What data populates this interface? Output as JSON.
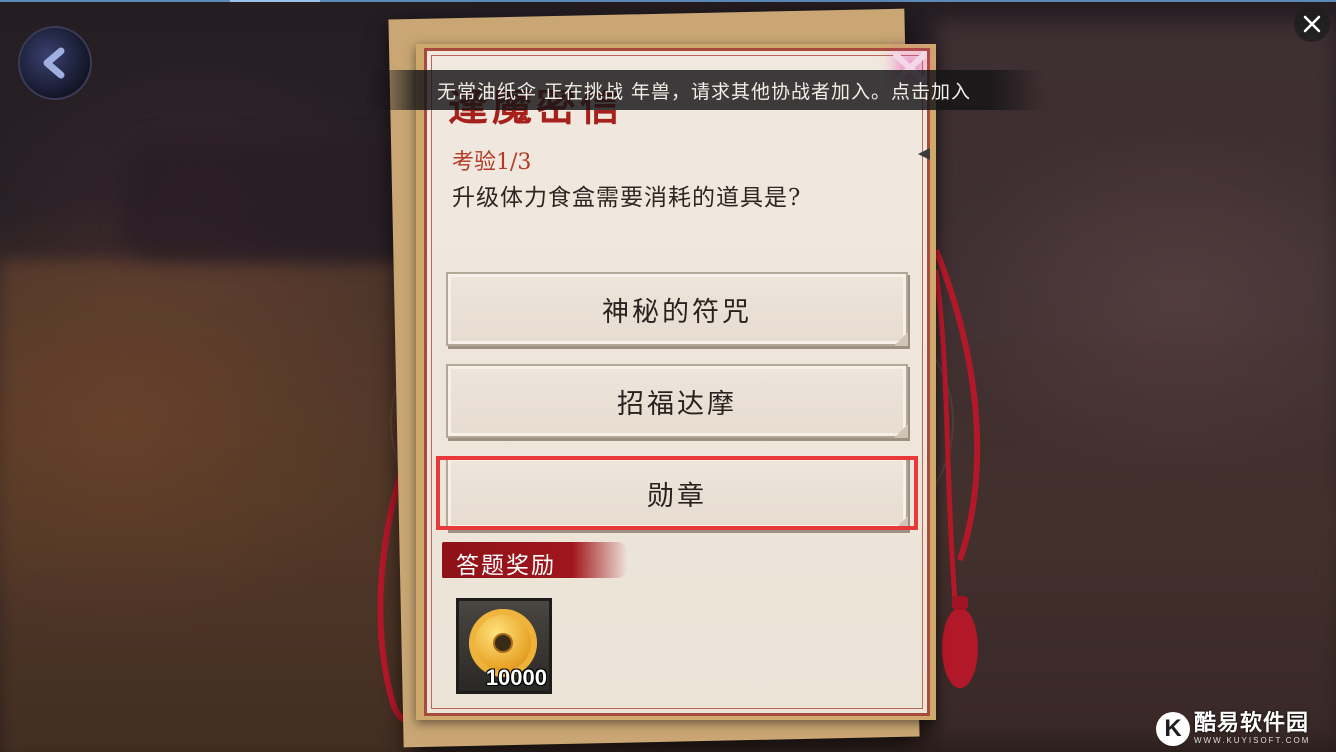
{
  "notice": {
    "text": "无常油纸伞 正在挑战 年兽，请求其他协战者加入。点击加入"
  },
  "card": {
    "title": "逢魔密信",
    "question_number": "考验1/3",
    "question_text": "升级体力食盒需要消耗的道具是?"
  },
  "options": [
    {
      "label": "神秘的符咒"
    },
    {
      "label": "招福达摩"
    },
    {
      "label": "勋章",
      "highlighted": true
    }
  ],
  "reward": {
    "label": "答题奖励",
    "item_icon": "coin-icon",
    "count": "10000"
  },
  "watermark": {
    "logo_letter": "K",
    "text": "酷易软件园",
    "url": "WWW.KUYISOFT.COM"
  },
  "colors": {
    "highlight": "#e8383a",
    "card_border": "#a84a3c",
    "title": "#a5211c",
    "question_number": "#b23a26",
    "reward_banner": "#a0161c"
  }
}
